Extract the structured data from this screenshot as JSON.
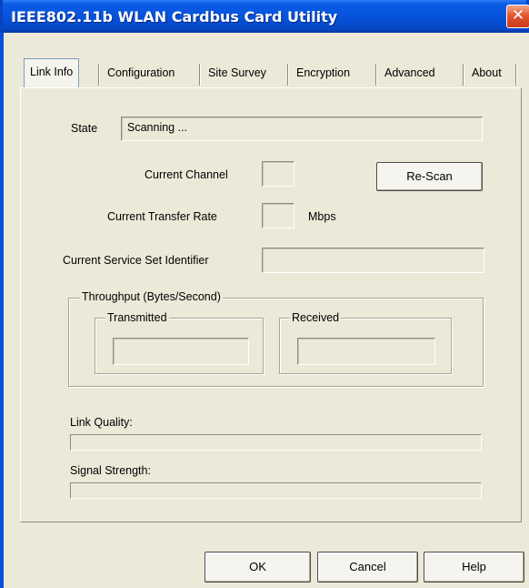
{
  "window": {
    "title": "IEEE802.11b WLAN Cardbus Card Utility",
    "close_glyph": "✕"
  },
  "tabs": [
    {
      "label": "Link Info",
      "active": true
    },
    {
      "label": "Configuration",
      "active": false
    },
    {
      "label": "Site Survey",
      "active": false
    },
    {
      "label": "Encryption",
      "active": false
    },
    {
      "label": "Advanced",
      "active": false
    },
    {
      "label": "About",
      "active": false
    }
  ],
  "link_info": {
    "state_label": "State",
    "state_value": "Scanning ...",
    "channel_label": "Current Channel",
    "channel_value": "",
    "rescan_label": "Re-Scan",
    "rate_label": "Current Transfer Rate",
    "rate_value": "",
    "rate_unit": "Mbps",
    "ssid_label": "Current Service Set Identifier",
    "ssid_value": "",
    "throughput": {
      "title": "Throughput (Bytes/Second)",
      "transmitted_label": "Transmitted",
      "transmitted_value": "",
      "received_label": "Received",
      "received_value": ""
    },
    "link_quality_label": "Link Quality:",
    "link_quality_level": 0,
    "signal_strength_label": "Signal Strength:",
    "signal_strength_level": 0
  },
  "footer": {
    "ok_label": "OK",
    "cancel_label": "Cancel",
    "help_label": "Help"
  },
  "icons": {
    "close": "close-icon"
  }
}
